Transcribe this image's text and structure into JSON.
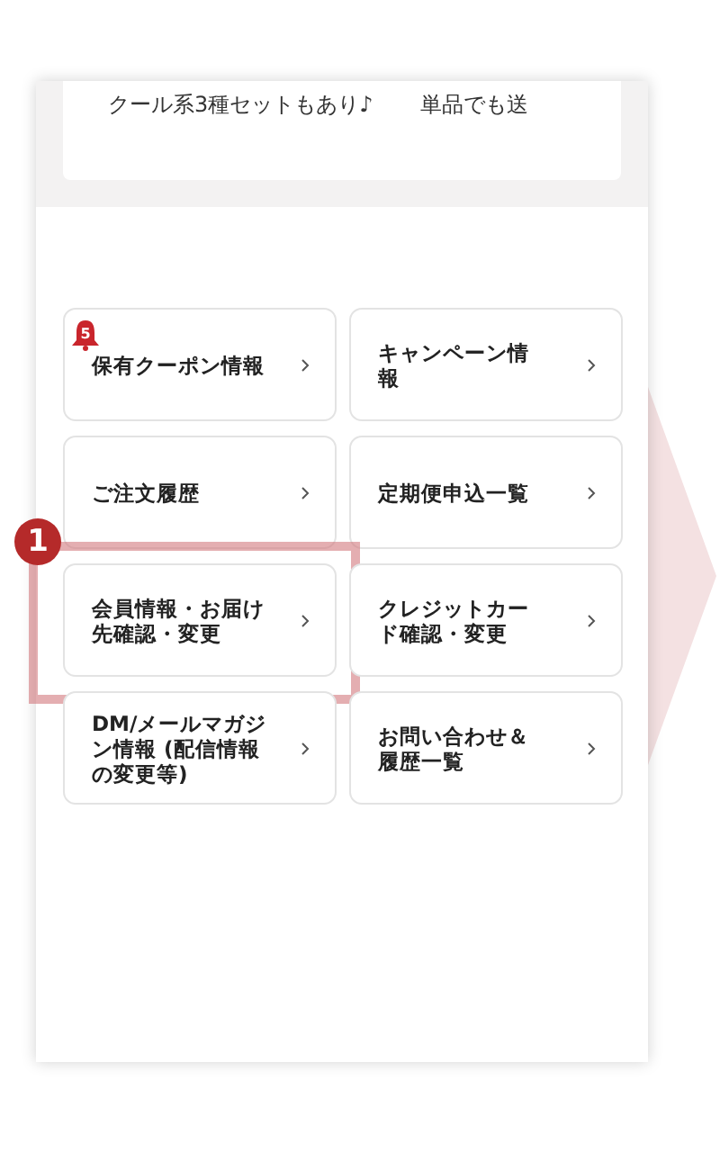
{
  "promo": {
    "texts": [
      "クール系3種セットもあり♪",
      "単品でも送"
    ]
  },
  "menu": [
    {
      "label": "保有クーポン情報",
      "badge": "5",
      "highlighted": false
    },
    {
      "label": "キャンペーン情報",
      "highlighted": false
    },
    {
      "label": "ご注文履歴",
      "highlighted": false
    },
    {
      "label": "定期便申込一覧",
      "highlighted": false
    },
    {
      "label": "会員情報・お届け先確認・変更",
      "highlighted": true,
      "step": "1"
    },
    {
      "label": "クレジットカード確認・変更",
      "highlighted": false
    },
    {
      "label": "DM/メールマガジン情報 (配信情報の変更等)",
      "highlighted": false
    },
    {
      "label": "お問い合わせ＆履歴一覧",
      "highlighted": false
    }
  ]
}
